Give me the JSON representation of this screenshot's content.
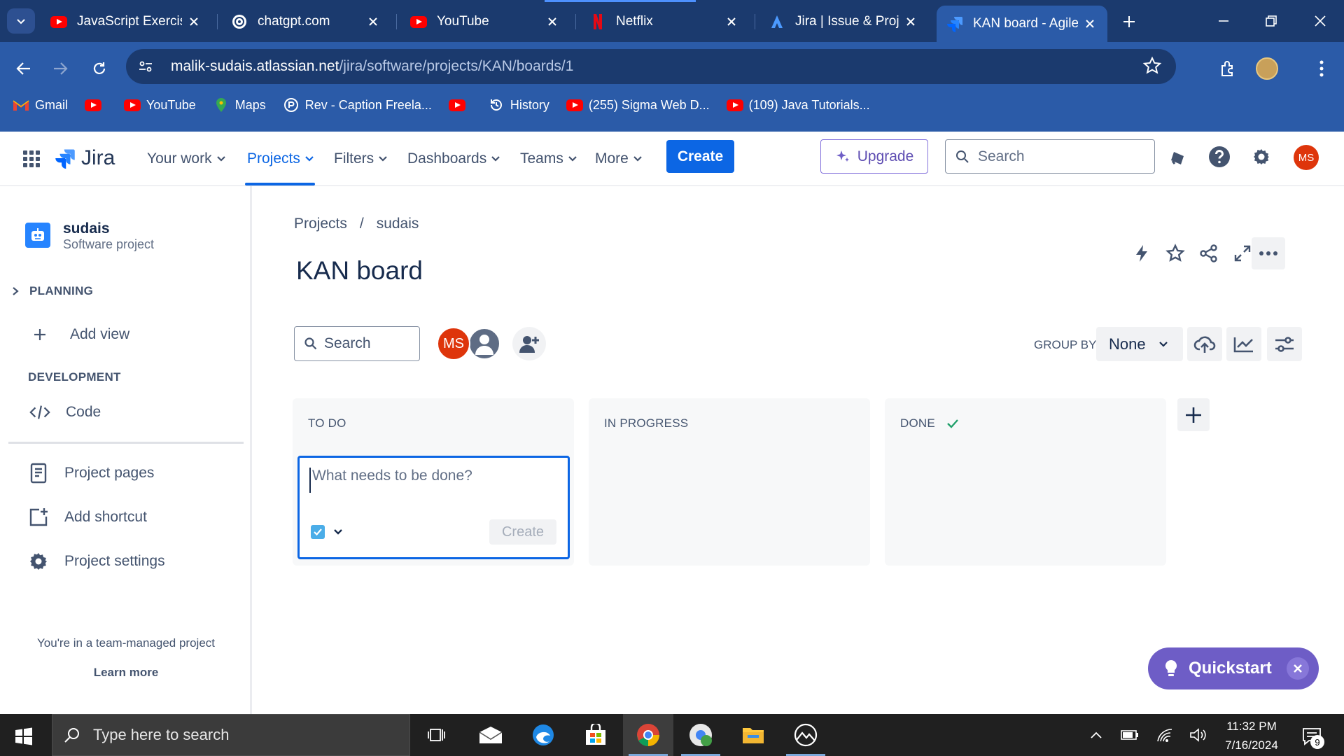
{
  "browser": {
    "tabs": [
      {
        "title": "JavaScript Exercise",
        "icon": "youtube-icon"
      },
      {
        "title": "chatgpt.com",
        "icon": "chatgpt-icon"
      },
      {
        "title": "YouTube",
        "icon": "youtube-icon"
      },
      {
        "title": "Netflix",
        "icon": "netflix-icon"
      },
      {
        "title": "Jira | Issue & Proje",
        "icon": "atlassian-icon"
      },
      {
        "title": "KAN board - Agile",
        "icon": "jira-icon",
        "active": true
      }
    ],
    "url_host": "malik-sudais.atlassian.net",
    "url_path": "/jira/software/projects/KAN/boards/1",
    "bookmarks": [
      {
        "label": "Gmail",
        "icon": "gmail-icon"
      },
      {
        "label": "",
        "icon": "youtube-icon"
      },
      {
        "label": "YouTube",
        "icon": "youtube-icon"
      },
      {
        "label": "Maps",
        "icon": "maps-icon"
      },
      {
        "label": "Rev - Caption Freela...",
        "icon": "rev-icon"
      },
      {
        "label": "",
        "icon": "youtube-icon"
      },
      {
        "label": "History",
        "icon": "history-icon"
      },
      {
        "label": "(255) Sigma Web D...",
        "icon": "youtube-icon"
      },
      {
        "label": "(109) Java Tutorials...",
        "icon": "youtube-icon"
      }
    ]
  },
  "jira_nav": {
    "logo": "Jira",
    "menu": {
      "your_work": "Your work",
      "projects": "Projects",
      "filters": "Filters",
      "dashboards": "Dashboards",
      "teams": "Teams",
      "more": "More"
    },
    "create_label": "Create",
    "upgrade_label": "Upgrade",
    "search_placeholder": "Search",
    "avatar_initials": "MS"
  },
  "sidebar": {
    "project_name": "sudais",
    "project_type": "Software project",
    "planning_label": "PLANNING",
    "add_view_label": "Add view",
    "development_label": "DEVELOPMENT",
    "code_label": "Code",
    "project_pages_label": "Project pages",
    "add_shortcut_label": "Add shortcut",
    "project_settings_label": "Project settings",
    "team_note": "You're in a team-managed project",
    "learn_more": "Learn more"
  },
  "board": {
    "breadcrumb": {
      "projects": "Projects",
      "separator": "/",
      "project": "sudais"
    },
    "title": "KAN board",
    "search_placeholder": "Search",
    "member_initials": "MS",
    "group_by_label": "GROUP BY",
    "group_by_value": "None",
    "columns": [
      {
        "title": "TO DO"
      },
      {
        "title": "IN PROGRESS"
      },
      {
        "title": "DONE",
        "done": true
      }
    ],
    "new_issue": {
      "placeholder": "What needs to be done?",
      "create_label": "Create"
    },
    "quickstart_label": "Quickstart"
  },
  "taskbar": {
    "search_placeholder": "Type here to search",
    "time": "11:32 PM",
    "date": "7/16/2024",
    "notification_count": "9"
  },
  "colors": {
    "jira_blue": "#0c66e4",
    "browser_toolbar": "#2b5ba8",
    "quickstart_purple": "#6e5dc6",
    "avatar_red": "#de350b"
  }
}
